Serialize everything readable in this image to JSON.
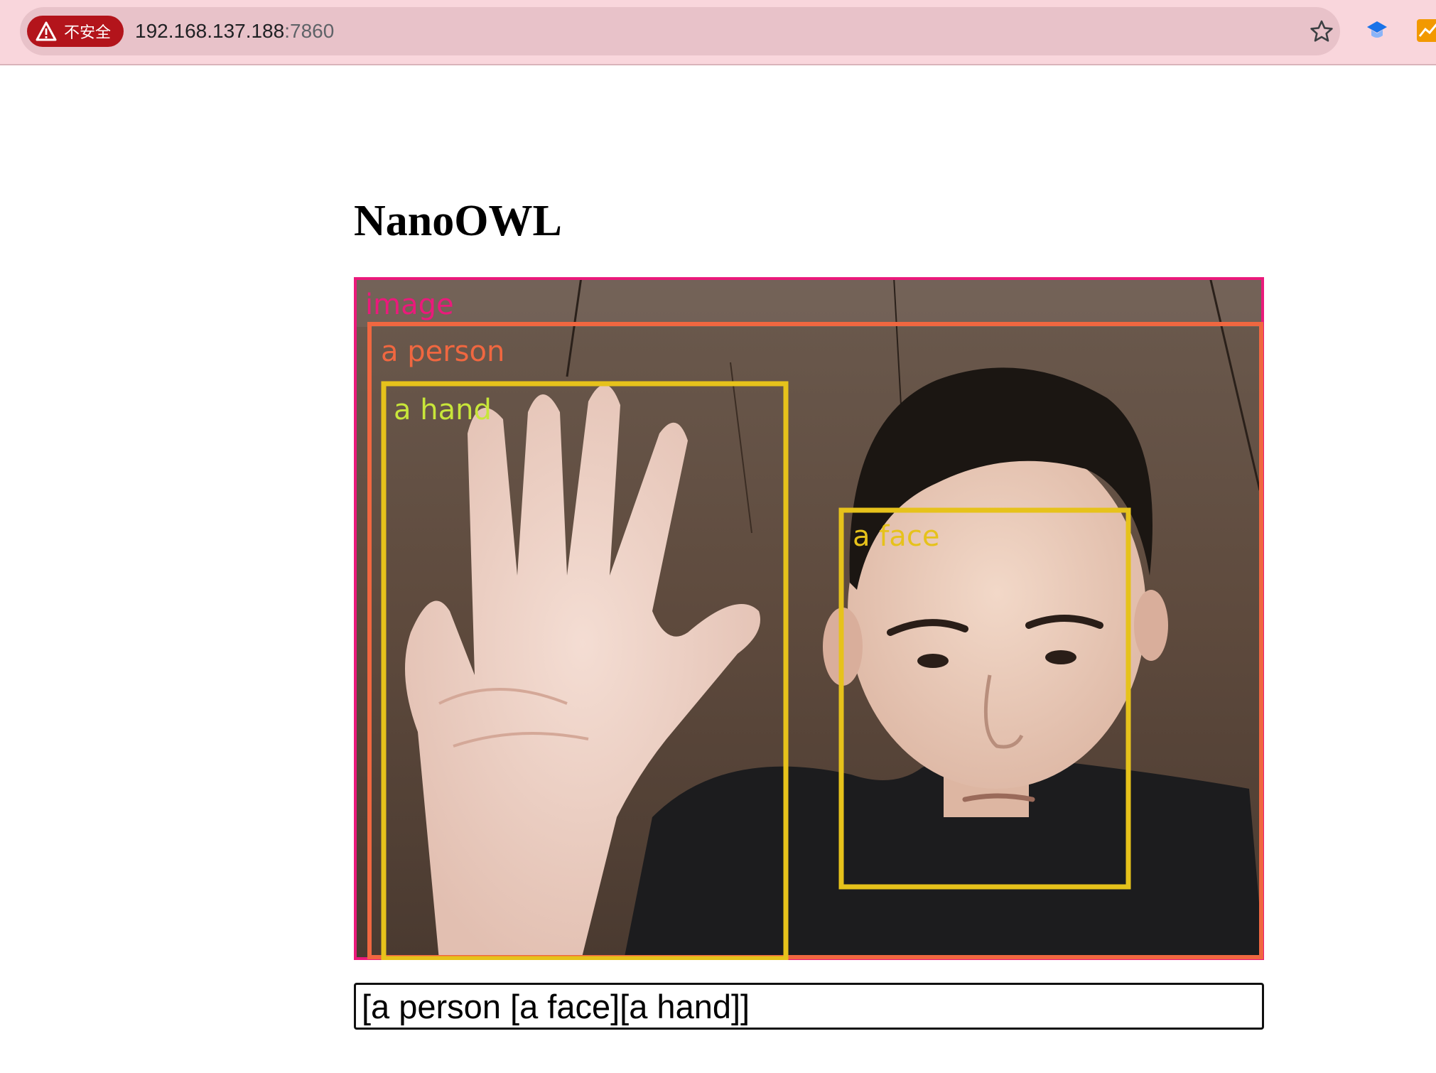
{
  "browser": {
    "security_chip": "不安全",
    "address": {
      "host": "192.168.137.188",
      "port": ":7860"
    },
    "icons": [
      "warning-icon",
      "bookmark-star-icon",
      "extension-icon",
      "extension-icon"
    ]
  },
  "page": {
    "title": "NanoOWL",
    "prompt_value": "[a person [a face][a hand]]"
  },
  "detections": [
    {
      "label": "image",
      "color": "#ea1a7b"
    },
    {
      "label": "a person",
      "color": "#f06740"
    },
    {
      "label": "a hand",
      "color": "#e6c21b",
      "label_color": "#c8e63a"
    },
    {
      "label": "a face",
      "color": "#e6c21b"
    }
  ]
}
